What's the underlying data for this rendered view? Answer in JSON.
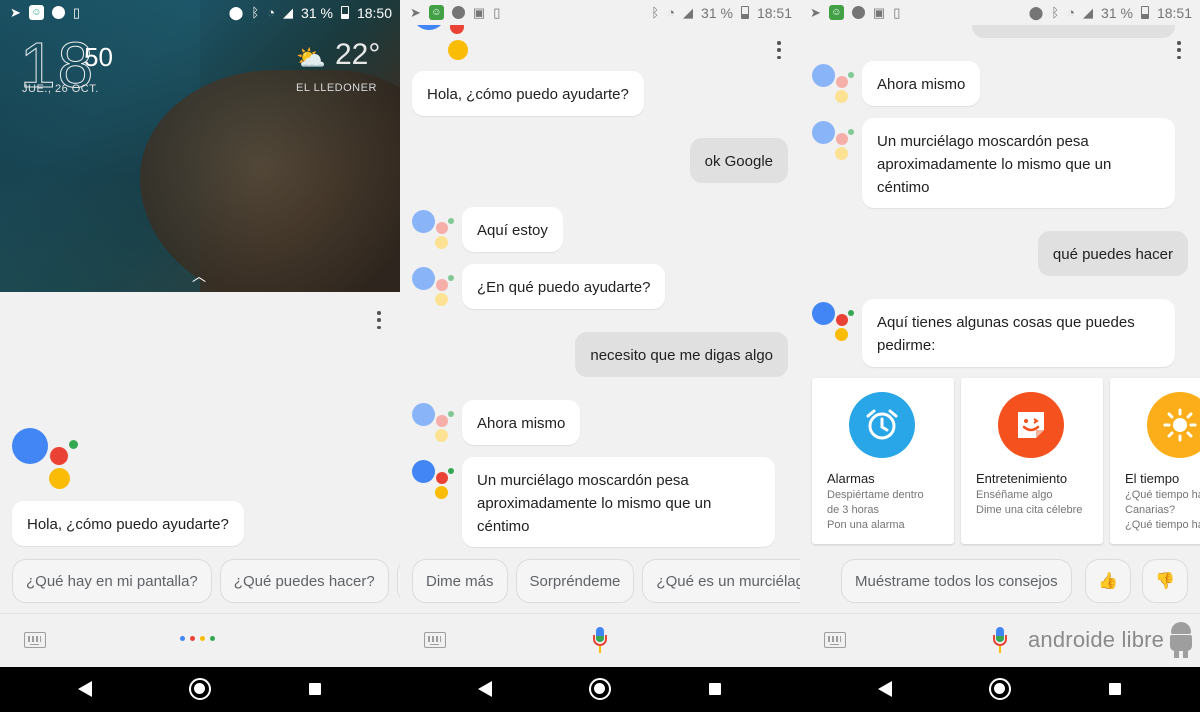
{
  "colors": {
    "blue": "#4285f4",
    "red": "#ea4335",
    "yellow": "#fbbc05",
    "green": "#34a853",
    "alarm": "#29a6e8",
    "entertainment": "#f4511e",
    "weather": "#fbad1a"
  },
  "panel1": {
    "status": {
      "left_icons": [
        "telegram-icon",
        "app-icon",
        "dnd-icon",
        "vibrate-icon"
      ],
      "battery": "31 %",
      "time": "18:50"
    },
    "lock": {
      "hour": "18",
      "minute": "50",
      "date": "JUE., 26 OCT.",
      "temp": "22°",
      "location": "EL LLEDONER",
      "weather_icon": "⛅"
    },
    "greeting": "Hola, ¿cómo puedo ayudarte?",
    "chips": [
      "¿Qué hay en mi pantalla?",
      "¿Qué puedes hacer?"
    ]
  },
  "panel2": {
    "status": {
      "battery": "31 %",
      "time": "18:51"
    },
    "messages": {
      "a1": "Hola, ¿cómo puedo ayudarte?",
      "u1": "ok Google",
      "a2": "Aquí estoy",
      "a3": "¿En qué puedo ayudarte?",
      "u2": "necesito que me digas algo",
      "a4": "Ahora mismo",
      "a5": "Un murciélago moscardón pesa aproximadamente lo mismo que un céntimo"
    },
    "chips": [
      "Dime más",
      "Sorpréndeme",
      "¿Qué es un murciélag"
    ]
  },
  "panel3": {
    "status": {
      "battery": "31 %",
      "time": "18:51"
    },
    "messages": {
      "a1": "Ahora mismo",
      "a2": "Un murciélago moscardón pesa aproximadamente lo mismo que un céntimo",
      "u1": "qué puedes hacer",
      "a3": "Aquí tienes algunas cosas que puedes pedirme:"
    },
    "cards": [
      {
        "title": "Alarmas",
        "line1": "Despiértame dentro",
        "line2": "de 3 horas",
        "line3": "Pon una alarma",
        "icon": "alarm-clock-icon"
      },
      {
        "title": "Entretenimiento",
        "line1": "Enséñame algo",
        "line2": "Dime una cita célebre",
        "line3": "",
        "icon": "sticker-icon"
      },
      {
        "title": "El tiempo",
        "line1": "¿Qué tiempo hace",
        "line2": "Canarias?",
        "line3": "¿Qué tiempo hace",
        "icon": "sun-icon"
      }
    ],
    "chip": "Muéstrame todos los consejos",
    "thumb_up": "👍",
    "thumb_down": "👎"
  },
  "watermark": "androide libre"
}
